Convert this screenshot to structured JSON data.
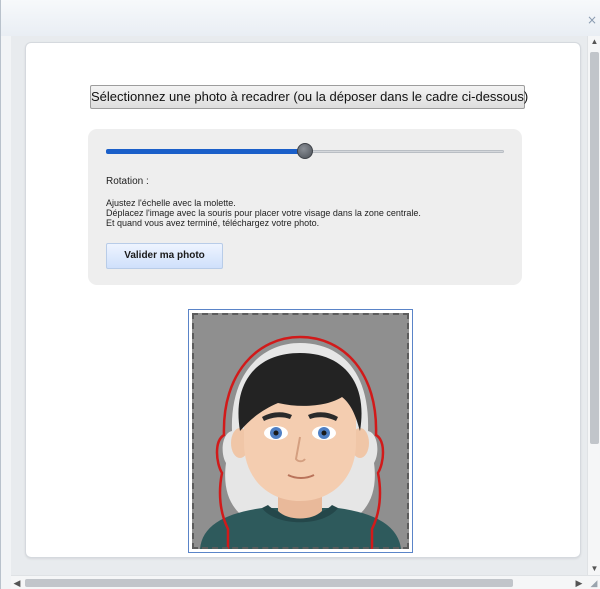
{
  "window": {
    "close_glyph": "×"
  },
  "toolbar": {
    "select_photo_label": "Sélectionnez une photo à recadrer (ou la déposer dans le cadre ci-dessous)"
  },
  "editor": {
    "zoom_slider": {
      "value": 0.5
    },
    "rotation_label": "Rotation :",
    "instructions": [
      "Ajustez l'échelle avec la molette.",
      "Déplacez l'image avec la souris pour placer votre visage dans la zone centrale.",
      "Et quand vous avez terminé, téléchargez votre photo."
    ],
    "validate_label": "Valider ma photo"
  },
  "colors": {
    "slider_fill": "#1a5fc9",
    "guide_outline": "#d11a1a",
    "photo_background": "#8f8f8f"
  },
  "icons": {
    "close": "close-icon",
    "scroll_up": "chevron-up-icon",
    "scroll_down": "chevron-down-icon",
    "scroll_left": "chevron-left-icon",
    "scroll_right": "chevron-right-icon",
    "resize": "resize-grip-icon"
  }
}
